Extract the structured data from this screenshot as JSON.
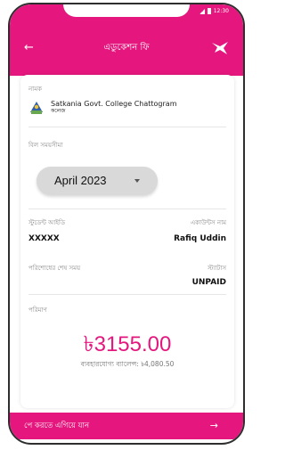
{
  "status_bar": {
    "time": "12:30"
  },
  "header": {
    "title": "এডুকেশন ফি",
    "back_icon": "arrow-left-icon",
    "logo_icon": "bird-logo-icon"
  },
  "institution": {
    "label": "নামক",
    "name": "Satkania Govt. College Chattogram",
    "sub": "কলেজ"
  },
  "month": {
    "label": "বিল সময়সীমা",
    "value": "April 2023"
  },
  "student": {
    "id_label": "স্টুডেন্ট আইডি",
    "id_value": "XXXXX",
    "name_label": "একাউন্টস নাম",
    "name_value": "Rafiq Uddin"
  },
  "payment": {
    "deadline_label": "পরিশোধের শেষ সময়",
    "status_label": "স্ট্যাটাস",
    "status_value": "UNPAID"
  },
  "amount": {
    "label": "পরিমাণ",
    "value": "৳3155.00",
    "balance_text": "ব্যবহারযোগ্য ব্যালেন্স: ৳4,080.50"
  },
  "footer": {
    "proceed_label": "পে করতে এগিয়ে যান"
  },
  "colors": {
    "accent": "#e5177e",
    "select_bg": "#d9d9d9"
  }
}
